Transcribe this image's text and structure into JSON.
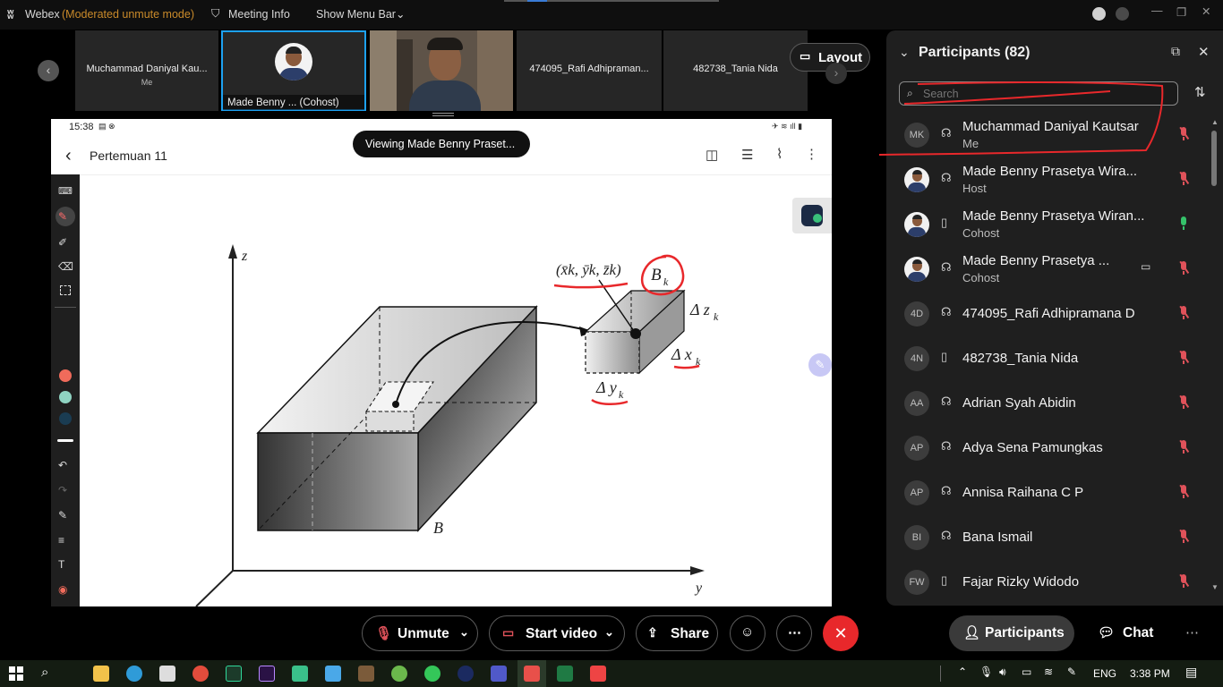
{
  "titlebar": {
    "app_name": "Webex",
    "mode": "(Moderated unmute mode)",
    "meeting_info": "Meeting Info",
    "show_menu_bar": "Show Menu Bar"
  },
  "thumbnails": [
    {
      "name": "Muchammad Daniyal Kau...",
      "sub": "Me"
    },
    {
      "name": "Made Benny ...  (Cohost)"
    },
    {
      "name": ""
    },
    {
      "name": "474095_Rafi Adhipraman..."
    },
    {
      "name": "482738_Tania Nida"
    }
  ],
  "layout_button": "Layout",
  "share": {
    "status_time": "15:38",
    "doc_title": "Pertemuan 11",
    "viewing_banner": "Viewing Made Benny Praset...",
    "figure": {
      "axis_z": "z",
      "axis_y": "y",
      "label_B": "B",
      "label_Bk": "B",
      "label_Bk_sub": "k",
      "point_label": "(x̄k, ȳk, z̄k)",
      "delta_z": "Δ z",
      "delta_x": "Δ x",
      "delta_y": "Δ y",
      "sub_k": "k"
    }
  },
  "panel": {
    "title": "Participants (82)",
    "search_placeholder": "Search",
    "participants": [
      {
        "initials": "MK",
        "name": "Muchammad Daniyal Kautsar",
        "role": "Me",
        "device": "headset",
        "mic": "muted"
      },
      {
        "initials": "",
        "name": "Made Benny Prasetya Wira...",
        "role": "Host",
        "device": "headset",
        "mic": "muted",
        "photo": true
      },
      {
        "initials": "",
        "name": "Made Benny Prasetya Wiran...",
        "role": "Cohost",
        "device": "phone",
        "mic": "on",
        "photo": true
      },
      {
        "initials": "",
        "name": "Made Benny Prasetya ...",
        "role": "Cohost",
        "device": "headset",
        "mic": "muted",
        "photo": true,
        "video": true
      },
      {
        "initials": "4D",
        "name": "474095_Rafi Adhipramana D",
        "role": "",
        "device": "headset",
        "mic": "muted"
      },
      {
        "initials": "4N",
        "name": "482738_Tania Nida",
        "role": "",
        "device": "phone",
        "mic": "muted"
      },
      {
        "initials": "AA",
        "name": "Adrian Syah Abidin",
        "role": "",
        "device": "headset",
        "mic": "muted"
      },
      {
        "initials": "AP",
        "name": "Adya Sena Pamungkas",
        "role": "",
        "device": "headset",
        "mic": "muted"
      },
      {
        "initials": "AP",
        "name": "Annisa Raihana C P",
        "role": "",
        "device": "headset",
        "mic": "muted"
      },
      {
        "initials": "BI",
        "name": "Bana Ismail",
        "role": "",
        "device": "headset",
        "mic": "muted"
      },
      {
        "initials": "FW",
        "name": "Fajar Rizky Widodo",
        "role": "",
        "device": "phone",
        "mic": "muted"
      }
    ]
  },
  "controls": {
    "unmute": "Unmute",
    "start_video": "Start video",
    "share": "Share",
    "participants": "Participants",
    "chat": "Chat"
  },
  "taskbar": {
    "lang": "ENG",
    "time": "3:38 PM"
  },
  "colors": {
    "accent_red": "#e8282b",
    "muted_red": "#e0525a",
    "mic_on_green": "#35c26a",
    "selected_blue": "#1da1f2"
  }
}
